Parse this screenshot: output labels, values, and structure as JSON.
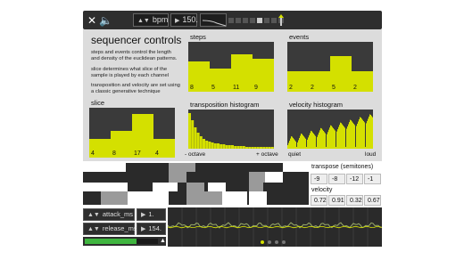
{
  "topbar": {
    "close_icon": "close-icon",
    "speaker_icon": "speaker-icon",
    "bpm_label": "bpm",
    "bpm_value": "150.",
    "step_cells": 8,
    "active_step": 4
  },
  "intro": {
    "title": "sequencer controls",
    "para1": "steps and events control the length and density of the euclidean patterns.",
    "para2": "slice determines what slice of the sample is played by each channel",
    "para3": "transposition and velocity are set using a classic generative technique"
  },
  "steps": {
    "label": "steps",
    "values": [
      8,
      5,
      11,
      9
    ],
    "max": 16,
    "labels": [
      "8",
      "5",
      "11",
      "9"
    ]
  },
  "events": {
    "label": "events",
    "values": [
      2,
      2,
      5,
      2
    ],
    "max": 8,
    "labels": [
      "2",
      "2",
      "5",
      "2"
    ]
  },
  "slice": {
    "label": "slice",
    "values": [
      4,
      8,
      17,
      4
    ],
    "max": 20,
    "labels": [
      "4",
      "8",
      "17",
      "4"
    ]
  },
  "transposition": {
    "label": "transposition histogram",
    "left_label": "- octave",
    "right_label": "+ octave"
  },
  "velocity": {
    "label": "velocity histogram",
    "left_label": "quiet",
    "right_label": "loud"
  },
  "right_info": {
    "transpose_label": "transpose (semitones)",
    "transpose_values": [
      "-9",
      "-8",
      "-12",
      "-1"
    ],
    "velocity_label": "velocity",
    "velocity_values": [
      "0.72",
      "0.91",
      "0.32",
      "0.67"
    ]
  },
  "controls": {
    "attack_label": "attack_ms",
    "attack_value": "1.",
    "release_label": "release_ms",
    "release_value": "154.",
    "level": 0.62
  },
  "colors": {
    "accent": "#d4e000",
    "dark": "#2e2e2e",
    "panel": "#dcdcdc"
  },
  "pages": {
    "count": 4,
    "active": 0
  }
}
